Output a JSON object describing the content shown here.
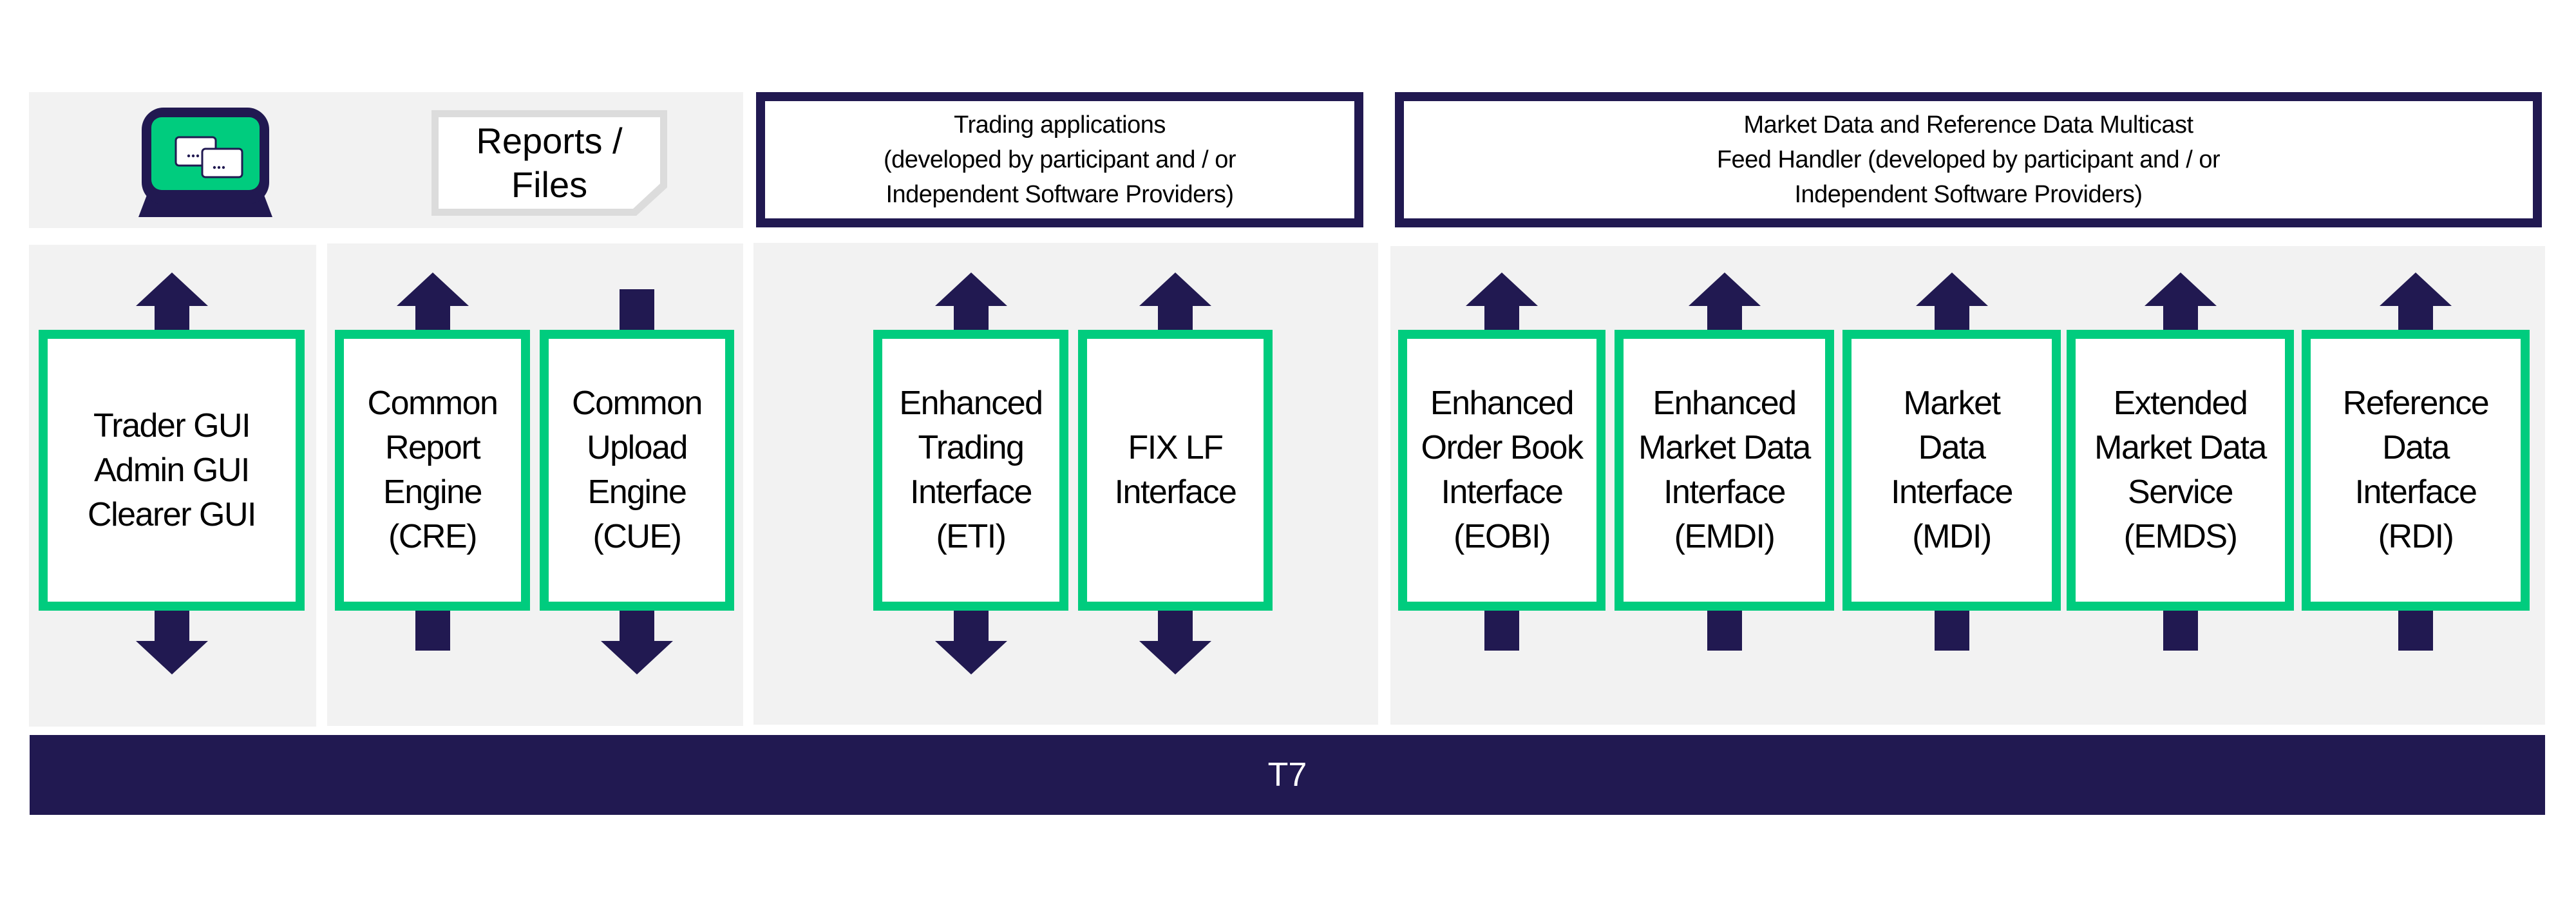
{
  "top_row": {
    "workstation_icon": "monitor-with-windows-icon",
    "reports_box": {
      "label": "Reports /\nFiles",
      "icon": "document-folded-corner-icon"
    },
    "trading_apps_box": {
      "lines": [
        "Trading applications",
        "(developed by participant and / or",
        "Independent Software Providers)"
      ]
    },
    "market_data_box": {
      "lines": [
        "Market Data and Reference Data Multicast",
        "Feed Handler (developed by participant and / or",
        "Independent Software Providers)"
      ]
    }
  },
  "components": [
    {
      "id": "gui",
      "label": "Trader GUI\nAdmin GUI\nClearer GUI",
      "top": "arrow-up",
      "bottom": "arrow-down"
    },
    {
      "id": "cre",
      "label": "Common\nReport\nEngine\n(CRE)",
      "top": "arrow-up",
      "bottom": "connector"
    },
    {
      "id": "cue",
      "label": "Common\nUpload\nEngine\n(CUE)",
      "top": "connector",
      "bottom": "arrow-down"
    },
    {
      "id": "eti",
      "label": "Enhanced\nTrading\nInterface\n(ETI)",
      "top": "arrow-up",
      "bottom": "arrow-down"
    },
    {
      "id": "fix",
      "label": "FIX LF\nInterface",
      "top": "arrow-up",
      "bottom": "arrow-down"
    },
    {
      "id": "eobi",
      "label": "Enhanced\nOrder Book\nInterface\n(EOBI)",
      "top": "arrow-up",
      "bottom": "connector"
    },
    {
      "id": "emdi",
      "label": "Enhanced\nMarket Data\nInterface\n(EMDI)",
      "top": "arrow-up",
      "bottom": "connector"
    },
    {
      "id": "mdi",
      "label": "Market\nData\nInterface\n(MDI)",
      "top": "arrow-up",
      "bottom": "connector"
    },
    {
      "id": "emds",
      "label": "Extended\nMarket Data\nService\n(EMDS)",
      "top": "arrow-up",
      "bottom": "connector"
    },
    {
      "id": "rdi",
      "label": "Reference\nData\nInterface\n(RDI)",
      "top": "arrow-up",
      "bottom": "connector"
    }
  ],
  "platform_bar": {
    "label": "T7"
  },
  "colors": {
    "navy": "#211951",
    "green": "#00cc7e",
    "panel_gray": "#f2f2f2",
    "doc_border_gray": "#dcdcdc"
  }
}
